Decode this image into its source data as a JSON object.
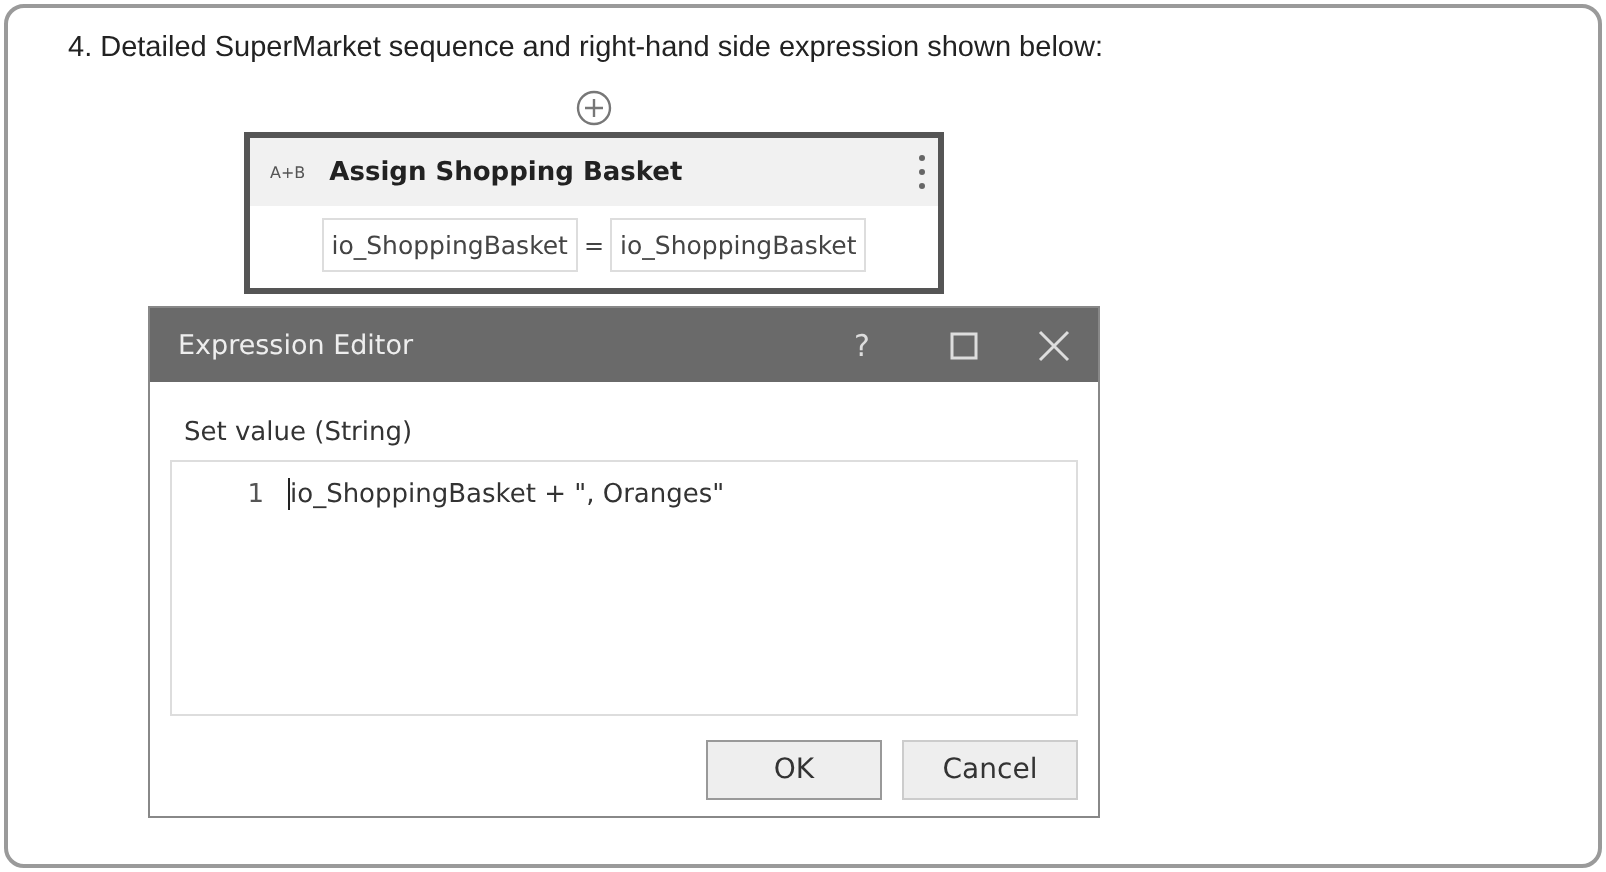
{
  "question": "4. Detailed SuperMarket sequence and right-hand side expression shown below:",
  "activity": {
    "type_badge": "A+B",
    "title": "Assign Shopping Basket",
    "left_field": "io_ShoppingBasket",
    "operator": "=",
    "right_field": "io_ShoppingBasket"
  },
  "dialog": {
    "title": "Expression Editor",
    "help": "?",
    "label": "Set value (String)",
    "lines": [
      {
        "number": "1",
        "code": "io_ShoppingBasket + \", Oranges\""
      }
    ],
    "buttons": [
      {
        "label": "OK",
        "selected": true
      },
      {
        "label": "Cancel",
        "selected": false
      }
    ]
  }
}
